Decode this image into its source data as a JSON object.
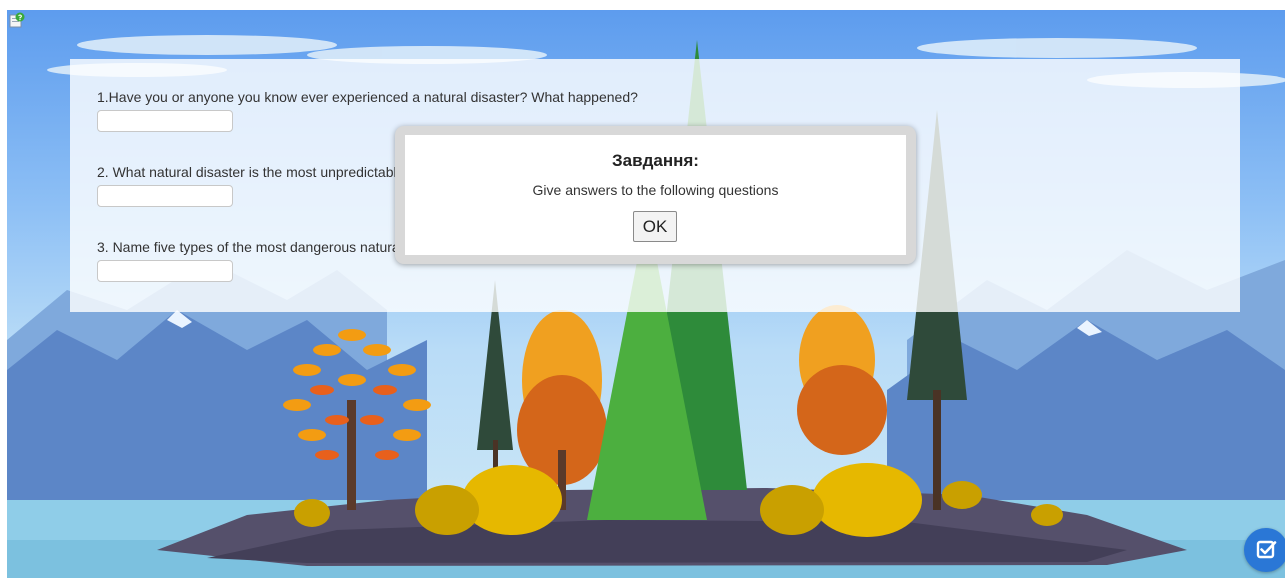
{
  "questions": [
    {
      "text": "1.Have you or anyone you know ever experienced a natural disaster? What happened?",
      "answer": ""
    },
    {
      "text": "2. What natural disaster is the most unpredictable?",
      "answer": ""
    },
    {
      "text": "3. Name five types of the most dangerous natural disasters.",
      "answer": ""
    }
  ],
  "dialog": {
    "title": "Завдання:",
    "message": "Give answers to the following questions",
    "ok_label": "OK"
  },
  "icons": {
    "help": "help-icon",
    "check": "check-answers-icon"
  },
  "colors": {
    "check_button": "#2a77d6",
    "sky": "#5d9cee"
  }
}
